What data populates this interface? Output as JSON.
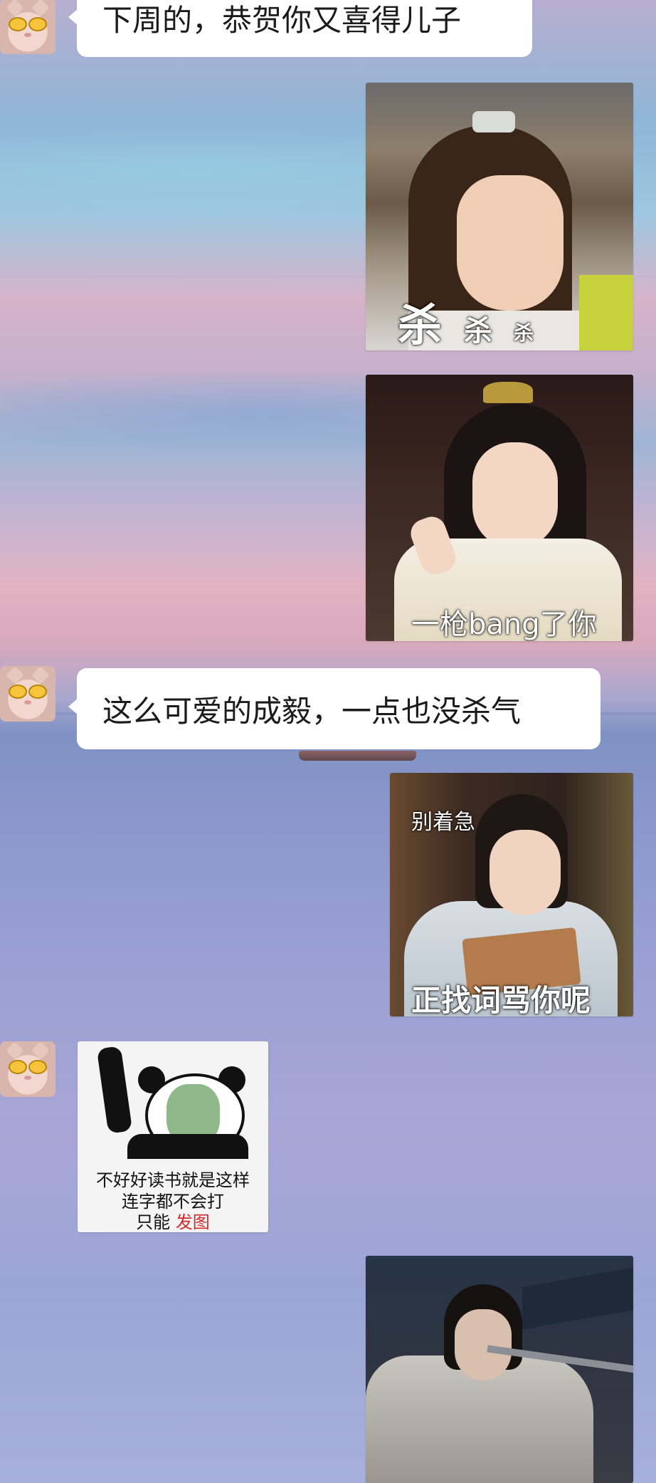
{
  "messages": {
    "m1_text": "下周的，恭贺你又喜得儿子",
    "m2_caption_big": "杀",
    "m2_caption_mid": "杀",
    "m2_caption_small": "杀",
    "m3_caption": "一枪bang了你",
    "m4_text": "这么可爱的成毅，一点也没杀气",
    "m5_caption_top": "别着急",
    "m5_caption_bottom": "正找词骂你呢",
    "m6_line1": "不好好读书就是这样",
    "m6_line2": "连字都不会打",
    "m6_line3_prefix": "只能 ",
    "m6_line3_red": "发图"
  },
  "colors": {
    "bubble": "#ffffff",
    "red_text": "#d52a2a"
  },
  "icons": {
    "avatar": "cat-with-sunglasses-avatar"
  }
}
